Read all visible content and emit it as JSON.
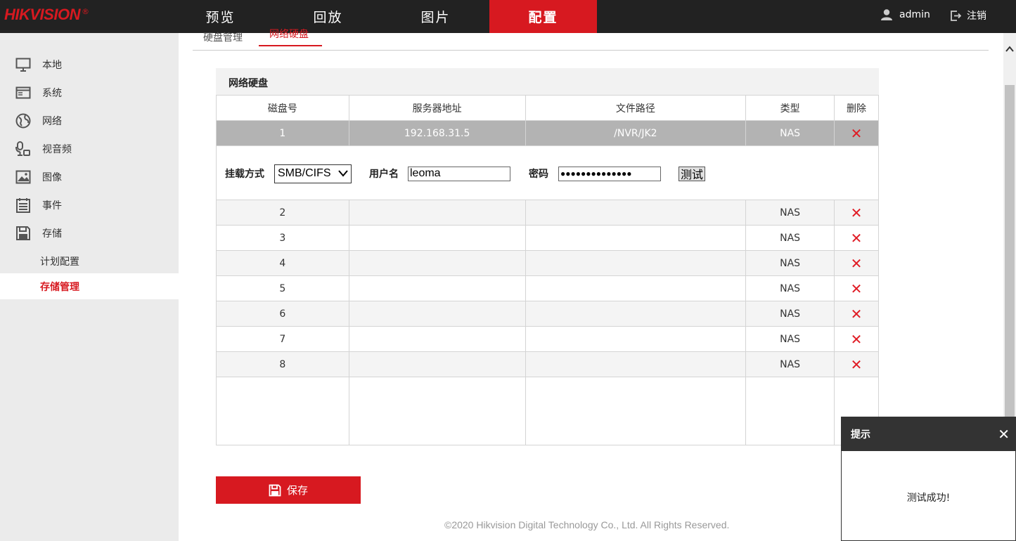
{
  "brand": {
    "name": "HIKVISION",
    "mark": "®"
  },
  "nav": [
    {
      "label": "预览"
    },
    {
      "label": "回放"
    },
    {
      "label": "图片"
    },
    {
      "label": "配置",
      "active": true
    }
  ],
  "user": {
    "name": "admin",
    "logout": "注销"
  },
  "sidebar": {
    "items": [
      {
        "label": "本地",
        "icon": "monitor-icon"
      },
      {
        "label": "系统",
        "icon": "window-icon"
      },
      {
        "label": "网络",
        "icon": "globe-icon"
      },
      {
        "label": "视音频",
        "icon": "microphone-camera-icon"
      },
      {
        "label": "图像",
        "icon": "image-icon"
      },
      {
        "label": "事件",
        "icon": "calendar-icon"
      },
      {
        "label": "存储",
        "icon": "floppy-disk-icon"
      }
    ],
    "sub_items": [
      {
        "label": "计划配置"
      },
      {
        "label": "存储管理",
        "active": true
      }
    ]
  },
  "tabs": [
    {
      "label": "硬盘管理"
    },
    {
      "label": "网络硬盘",
      "active": true
    }
  ],
  "panel": {
    "title": "网络硬盘",
    "columns": [
      "磁盘号",
      "服务器地址",
      "文件路径",
      "类型",
      "删除"
    ],
    "selected_row": {
      "id": "1",
      "address": "192.168.31.5",
      "path": "/NVR/JK2",
      "type": "NAS"
    },
    "edit": {
      "mount_label": "挂载方式",
      "mount_value": "SMB/CIFS",
      "username_label": "用户名",
      "username_value": "leoma",
      "password_label": "密码",
      "password_value": "●●●●●●●●●●●●●●",
      "test_label": "测试"
    },
    "rows": [
      {
        "id": "2",
        "address": "",
        "path": "",
        "type": "NAS"
      },
      {
        "id": "3",
        "address": "",
        "path": "",
        "type": "NAS"
      },
      {
        "id": "4",
        "address": "",
        "path": "",
        "type": "NAS"
      },
      {
        "id": "5",
        "address": "",
        "path": "",
        "type": "NAS"
      },
      {
        "id": "6",
        "address": "",
        "path": "",
        "type": "NAS"
      },
      {
        "id": "7",
        "address": "",
        "path": "",
        "type": "NAS"
      },
      {
        "id": "8",
        "address": "",
        "path": "",
        "type": "NAS"
      }
    ],
    "delete_glyph": "✕"
  },
  "save": {
    "label": "保存"
  },
  "footer": "©2020 Hikvision Digital Technology Co., Ltd. All Rights Reserved.",
  "toast": {
    "title": "提示",
    "message": "测试成功!",
    "close": "✕"
  },
  "colors": {
    "accent": "#d71920",
    "topbar": "#222222",
    "sidebar": "#ebebeb",
    "selected_row": "#b3b3b3"
  }
}
